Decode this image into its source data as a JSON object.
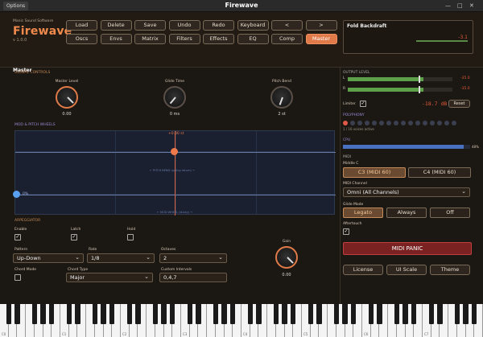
{
  "window": {
    "title": "Firewave",
    "options_label": "Options",
    "minimize": "—",
    "maximize": "□",
    "close": "✕"
  },
  "brand": {
    "subtitle": "Manic Sound Software",
    "name": "Firewave",
    "version": "v 1.0.0"
  },
  "nav_row1": [
    "Load",
    "Delete",
    "Save",
    "Undo",
    "Redo",
    "Keyboard",
    "<",
    ">"
  ],
  "nav_row2": [
    "Oscs",
    "Envs",
    "Matrix",
    "Filters",
    "Effects",
    "EQ",
    "Comp",
    "Master"
  ],
  "active_tab": "Master",
  "preset": {
    "name": "Fold Backdraft",
    "value": "-3.1",
    "meter_icon": "level-meter-icon"
  },
  "section_label": "Master",
  "global_controls": {
    "label": "GLOBAL CONTROLS",
    "knobs": [
      {
        "label": "Master Level",
        "value": "0.00"
      },
      {
        "label": "Glide Time",
        "value": "0 ms"
      },
      {
        "label": "Pitch Bend",
        "value": "2 st"
      }
    ]
  },
  "mod_wheels": {
    "label": "MOD & PITCH WHEELS",
    "pitch_value": "+0.00 st",
    "pitch_caption": "← PITCH BEND (spring return) →",
    "mod_value": "0%",
    "mod_caption": "← MOD WHEEL (sticky) →"
  },
  "arpeggiator": {
    "label": "ARPEGGIATOR",
    "enable_label": "Enable",
    "enable_checked": true,
    "latch_label": "Latch",
    "latch_checked": true,
    "hold_label": "Hold",
    "hold_checked": false,
    "pattern_label": "Pattern",
    "pattern_value": "Up-Down",
    "rate_label": "Rate",
    "rate_value": "1/8",
    "octaves_label": "Octaves",
    "octaves_value": "2",
    "chord_mode_label": "Chord Mode",
    "chord_mode_checked": false,
    "chord_type_label": "Chord Type",
    "chord_type_value": "Major",
    "custom_label": "Custom Intervals",
    "custom_value": "0,4,7",
    "gain_label": "Gain",
    "gain_value": "0.00"
  },
  "output": {
    "label": "OUTPUT LEVEL",
    "left_label": "L",
    "right_label": "R",
    "left_value": "-35.0",
    "right_value": "-35.0",
    "left_fill": 0.72,
    "right_fill": 0.72,
    "limiter_label": "Limiter",
    "limiter_checked": true,
    "limit_value": "-18.7 dB",
    "reset_label": "Reset"
  },
  "polyphony": {
    "label": "POLYPHONY",
    "active": 1,
    "total": 16,
    "caption": "1 / 16 voices active"
  },
  "cpu": {
    "label": "CPU",
    "value": "48%",
    "fill": 0.95
  },
  "midi": {
    "label": "MIDI",
    "middle_c_label": "Middle C",
    "middle_c_options": [
      "C3 (MIDI 60)",
      "C4 (MIDI 60)"
    ],
    "middle_c_active": 0,
    "channel_label": "MIDI Channel",
    "channel_value": "Omni (All Channels)",
    "glide_label": "Glide Mode",
    "glide_options": [
      "Legato",
      "Always",
      "Off"
    ],
    "glide_active": 0,
    "aftertouch_label": "Aftertouch",
    "aftertouch_checked": true
  },
  "panic_label": "MIDI PANIC",
  "footer_buttons": [
    "License",
    "UI Scale",
    "Theme"
  ],
  "keyboard": {
    "labels": [
      "C0",
      "C1",
      "C2",
      "C3",
      "C4",
      "C5",
      "C6",
      "C7"
    ]
  }
}
